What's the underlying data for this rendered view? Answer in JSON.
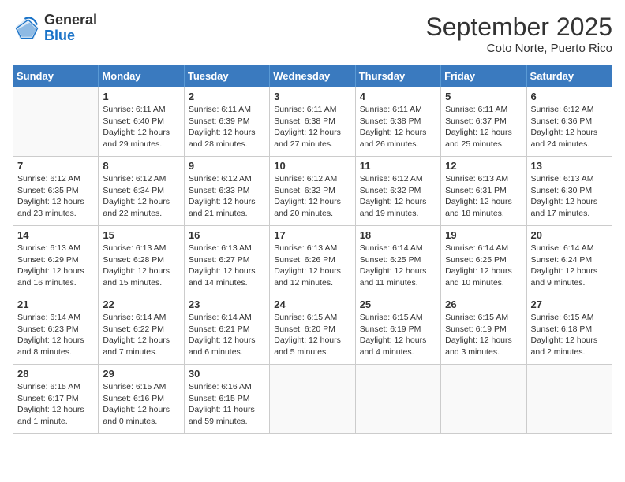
{
  "logo": {
    "general": "General",
    "blue": "Blue"
  },
  "header": {
    "month": "September 2025",
    "location": "Coto Norte, Puerto Rico"
  },
  "weekdays": [
    "Sunday",
    "Monday",
    "Tuesday",
    "Wednesday",
    "Thursday",
    "Friday",
    "Saturday"
  ],
  "weeks": [
    [
      {
        "day": "",
        "info": ""
      },
      {
        "day": "1",
        "info": "Sunrise: 6:11 AM\nSunset: 6:40 PM\nDaylight: 12 hours\nand 29 minutes."
      },
      {
        "day": "2",
        "info": "Sunrise: 6:11 AM\nSunset: 6:39 PM\nDaylight: 12 hours\nand 28 minutes."
      },
      {
        "day": "3",
        "info": "Sunrise: 6:11 AM\nSunset: 6:38 PM\nDaylight: 12 hours\nand 27 minutes."
      },
      {
        "day": "4",
        "info": "Sunrise: 6:11 AM\nSunset: 6:38 PM\nDaylight: 12 hours\nand 26 minutes."
      },
      {
        "day": "5",
        "info": "Sunrise: 6:11 AM\nSunset: 6:37 PM\nDaylight: 12 hours\nand 25 minutes."
      },
      {
        "day": "6",
        "info": "Sunrise: 6:12 AM\nSunset: 6:36 PM\nDaylight: 12 hours\nand 24 minutes."
      }
    ],
    [
      {
        "day": "7",
        "info": "Sunrise: 6:12 AM\nSunset: 6:35 PM\nDaylight: 12 hours\nand 23 minutes."
      },
      {
        "day": "8",
        "info": "Sunrise: 6:12 AM\nSunset: 6:34 PM\nDaylight: 12 hours\nand 22 minutes."
      },
      {
        "day": "9",
        "info": "Sunrise: 6:12 AM\nSunset: 6:33 PM\nDaylight: 12 hours\nand 21 minutes."
      },
      {
        "day": "10",
        "info": "Sunrise: 6:12 AM\nSunset: 6:32 PM\nDaylight: 12 hours\nand 20 minutes."
      },
      {
        "day": "11",
        "info": "Sunrise: 6:12 AM\nSunset: 6:32 PM\nDaylight: 12 hours\nand 19 minutes."
      },
      {
        "day": "12",
        "info": "Sunrise: 6:13 AM\nSunset: 6:31 PM\nDaylight: 12 hours\nand 18 minutes."
      },
      {
        "day": "13",
        "info": "Sunrise: 6:13 AM\nSunset: 6:30 PM\nDaylight: 12 hours\nand 17 minutes."
      }
    ],
    [
      {
        "day": "14",
        "info": "Sunrise: 6:13 AM\nSunset: 6:29 PM\nDaylight: 12 hours\nand 16 minutes."
      },
      {
        "day": "15",
        "info": "Sunrise: 6:13 AM\nSunset: 6:28 PM\nDaylight: 12 hours\nand 15 minutes."
      },
      {
        "day": "16",
        "info": "Sunrise: 6:13 AM\nSunset: 6:27 PM\nDaylight: 12 hours\nand 14 minutes."
      },
      {
        "day": "17",
        "info": "Sunrise: 6:13 AM\nSunset: 6:26 PM\nDaylight: 12 hours\nand 12 minutes."
      },
      {
        "day": "18",
        "info": "Sunrise: 6:14 AM\nSunset: 6:25 PM\nDaylight: 12 hours\nand 11 minutes."
      },
      {
        "day": "19",
        "info": "Sunrise: 6:14 AM\nSunset: 6:25 PM\nDaylight: 12 hours\nand 10 minutes."
      },
      {
        "day": "20",
        "info": "Sunrise: 6:14 AM\nSunset: 6:24 PM\nDaylight: 12 hours\nand 9 minutes."
      }
    ],
    [
      {
        "day": "21",
        "info": "Sunrise: 6:14 AM\nSunset: 6:23 PM\nDaylight: 12 hours\nand 8 minutes."
      },
      {
        "day": "22",
        "info": "Sunrise: 6:14 AM\nSunset: 6:22 PM\nDaylight: 12 hours\nand 7 minutes."
      },
      {
        "day": "23",
        "info": "Sunrise: 6:14 AM\nSunset: 6:21 PM\nDaylight: 12 hours\nand 6 minutes."
      },
      {
        "day": "24",
        "info": "Sunrise: 6:15 AM\nSunset: 6:20 PM\nDaylight: 12 hours\nand 5 minutes."
      },
      {
        "day": "25",
        "info": "Sunrise: 6:15 AM\nSunset: 6:19 PM\nDaylight: 12 hours\nand 4 minutes."
      },
      {
        "day": "26",
        "info": "Sunrise: 6:15 AM\nSunset: 6:19 PM\nDaylight: 12 hours\nand 3 minutes."
      },
      {
        "day": "27",
        "info": "Sunrise: 6:15 AM\nSunset: 6:18 PM\nDaylight: 12 hours\nand 2 minutes."
      }
    ],
    [
      {
        "day": "28",
        "info": "Sunrise: 6:15 AM\nSunset: 6:17 PM\nDaylight: 12 hours\nand 1 minute."
      },
      {
        "day": "29",
        "info": "Sunrise: 6:15 AM\nSunset: 6:16 PM\nDaylight: 12 hours\nand 0 minutes."
      },
      {
        "day": "30",
        "info": "Sunrise: 6:16 AM\nSunset: 6:15 PM\nDaylight: 11 hours\nand 59 minutes."
      },
      {
        "day": "",
        "info": ""
      },
      {
        "day": "",
        "info": ""
      },
      {
        "day": "",
        "info": ""
      },
      {
        "day": "",
        "info": ""
      }
    ]
  ]
}
